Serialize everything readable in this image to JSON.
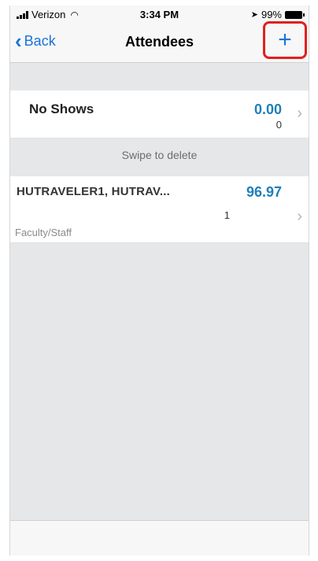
{
  "status_bar": {
    "carrier": "Verizon",
    "time": "3:34 PM",
    "battery": "99%"
  },
  "nav": {
    "back_label": "Back",
    "title": "Attendees",
    "add_label": "+"
  },
  "no_shows": {
    "label": "No Shows",
    "amount": "0.00",
    "count": "0"
  },
  "swipe_hint": "Swipe to delete",
  "attendees": [
    {
      "name": "HUTRAVELER1, HUTRAV...",
      "amount": "96.97",
      "count": "1",
      "type": "Faculty/Staff"
    }
  ],
  "colors": {
    "accent": "#1a73d9",
    "amount": "#1f7fb8",
    "highlight": "#e0201f"
  }
}
